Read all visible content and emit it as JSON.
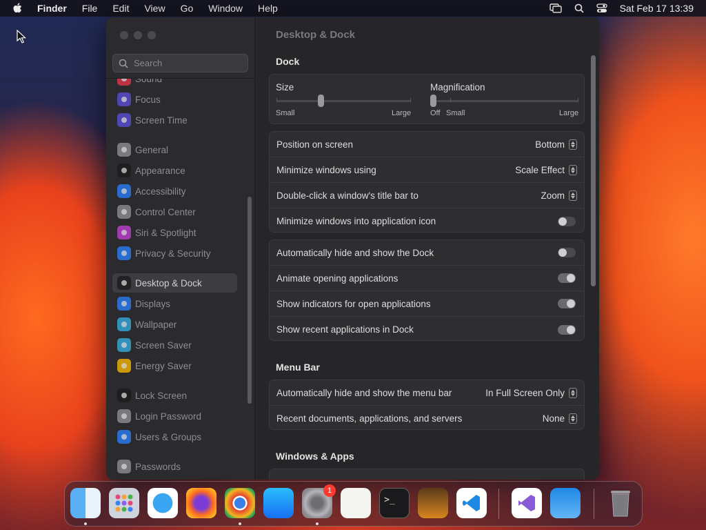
{
  "menubar": {
    "app": "Finder",
    "items": [
      "File",
      "Edit",
      "View",
      "Go",
      "Window",
      "Help"
    ],
    "datetime": "Sat Feb 17  13:39"
  },
  "window": {
    "search_placeholder": "Search",
    "sidebar": [
      {
        "label": "Sound",
        "icon": "sound-icon",
        "color": "#e0364a"
      },
      {
        "label": "Focus",
        "icon": "moon-icon",
        "color": "#5b4fd6"
      },
      {
        "label": "Screen Time",
        "icon": "hourglass-icon",
        "color": "#5b4fd6"
      },
      {
        "label": "General",
        "icon": "gear-icon",
        "color": "#8e8e93"
      },
      {
        "label": "Appearance",
        "icon": "appearance-icon",
        "color": "#1c1c1e"
      },
      {
        "label": "Accessibility",
        "icon": "accessibility-icon",
        "color": "#2a7cf6"
      },
      {
        "label": "Control Center",
        "icon": "control-center-icon",
        "color": "#8e8e93"
      },
      {
        "label": "Siri & Spotlight",
        "icon": "siri-icon",
        "color": "#c23fd1"
      },
      {
        "label": "Privacy & Security",
        "icon": "hand-icon",
        "color": "#2a7cf6"
      },
      {
        "label": "Desktop & Dock",
        "icon": "dock-icon",
        "color": "#1c1c1e"
      },
      {
        "label": "Displays",
        "icon": "sun-icon",
        "color": "#2a7cf6"
      },
      {
        "label": "Wallpaper",
        "icon": "wallpaper-icon",
        "color": "#34aadc"
      },
      {
        "label": "Screen Saver",
        "icon": "screen-saver-icon",
        "color": "#34aadc"
      },
      {
        "label": "Energy Saver",
        "icon": "bulb-icon",
        "color": "#f4b400"
      },
      {
        "label": "Lock Screen",
        "icon": "lock-icon",
        "color": "#1c1c1e"
      },
      {
        "label": "Login Password",
        "icon": "lock-icon",
        "color": "#8e8e93"
      },
      {
        "label": "Users & Groups",
        "icon": "users-icon",
        "color": "#2a7cf6"
      },
      {
        "label": "Passwords",
        "icon": "key-icon",
        "color": "#8e8e93"
      }
    ],
    "title": "Desktop & Dock",
    "dock_section": {
      "title": "Dock",
      "size_label": "Size",
      "size_small": "Small",
      "size_large": "Large",
      "size_value": 0.33,
      "mag_label": "Magnification",
      "mag_off": "Off",
      "mag_small": "Small",
      "mag_large": "Large",
      "mag_value": 0.0
    },
    "rows1": [
      {
        "label": "Position on screen",
        "value": "Bottom"
      },
      {
        "label": "Minimize windows using",
        "value": "Scale Effect"
      },
      {
        "label": "Double-click a window's title bar to",
        "value": "Zoom"
      },
      {
        "label": "Minimize windows into application icon",
        "toggle": false
      }
    ],
    "rows2": [
      {
        "label": "Automatically hide and show the Dock",
        "toggle": false
      },
      {
        "label": "Animate opening applications",
        "toggle": true
      },
      {
        "label": "Show indicators for open applications",
        "toggle": true
      },
      {
        "label": "Show recent applications in Dock",
        "toggle": true
      }
    ],
    "menubar_section": {
      "title": "Menu Bar",
      "rows": [
        {
          "label": "Automatically hide and show the menu bar",
          "value": "In Full Screen Only"
        },
        {
          "label": "Recent documents, applications, and servers",
          "value": "None"
        }
      ]
    },
    "windows_apps_title": "Windows & Apps"
  },
  "dock": {
    "apps": [
      "finder-icon",
      "launchpad-icon",
      "safari-icon",
      "firefox-icon",
      "chrome-icon",
      "app-store-icon",
      "system-settings-icon",
      "textedit-icon",
      "terminal-icon",
      "garageband-icon",
      "vscode-icon",
      "visual-studio-icon",
      "weather-icon",
      "trash-icon"
    ],
    "badge": "1"
  }
}
